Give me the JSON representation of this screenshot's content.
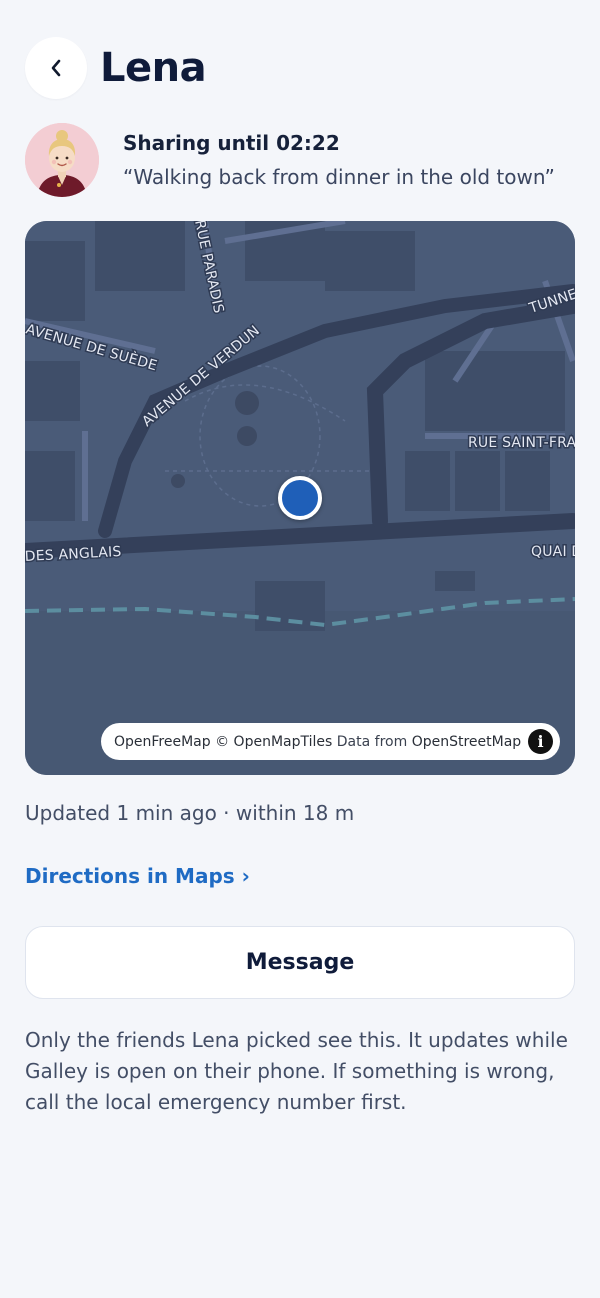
{
  "header": {
    "back_icon": "chevron-left-icon",
    "title": "Lena"
  },
  "share": {
    "until": "Sharing until 02:22",
    "note": "“Walking back from dinner in the old town”"
  },
  "map": {
    "streets": [
      "RUE PARADIS",
      "AVENUE DE SUÈDE",
      "AVENUE DE VERDUN",
      "TUNNE",
      "RUE SAINT-FRA",
      "DES ANGLAIS",
      "QUAI D"
    ],
    "attribution": {
      "openfreemap": "OpenFreeMap",
      "openmaptiles": "© OpenMapTiles",
      "data_from": "Data from",
      "osm": "OpenStreetMap"
    },
    "info_icon": "info-icon"
  },
  "status": {
    "updated": "Updated 1 min ago · within 18 m"
  },
  "actions": {
    "directions": "Directions in Maps ›",
    "message": "Message"
  },
  "disclaimer": "Only the friends Lena picked see this. It updates while Galley is open on their phone. If something is wrong, call the local emergency number first.",
  "colors": {
    "background": "#f4f6fa",
    "accent": "#1f6bc4",
    "map_bg": "#475873",
    "location_dot": "#1f5fb8"
  }
}
